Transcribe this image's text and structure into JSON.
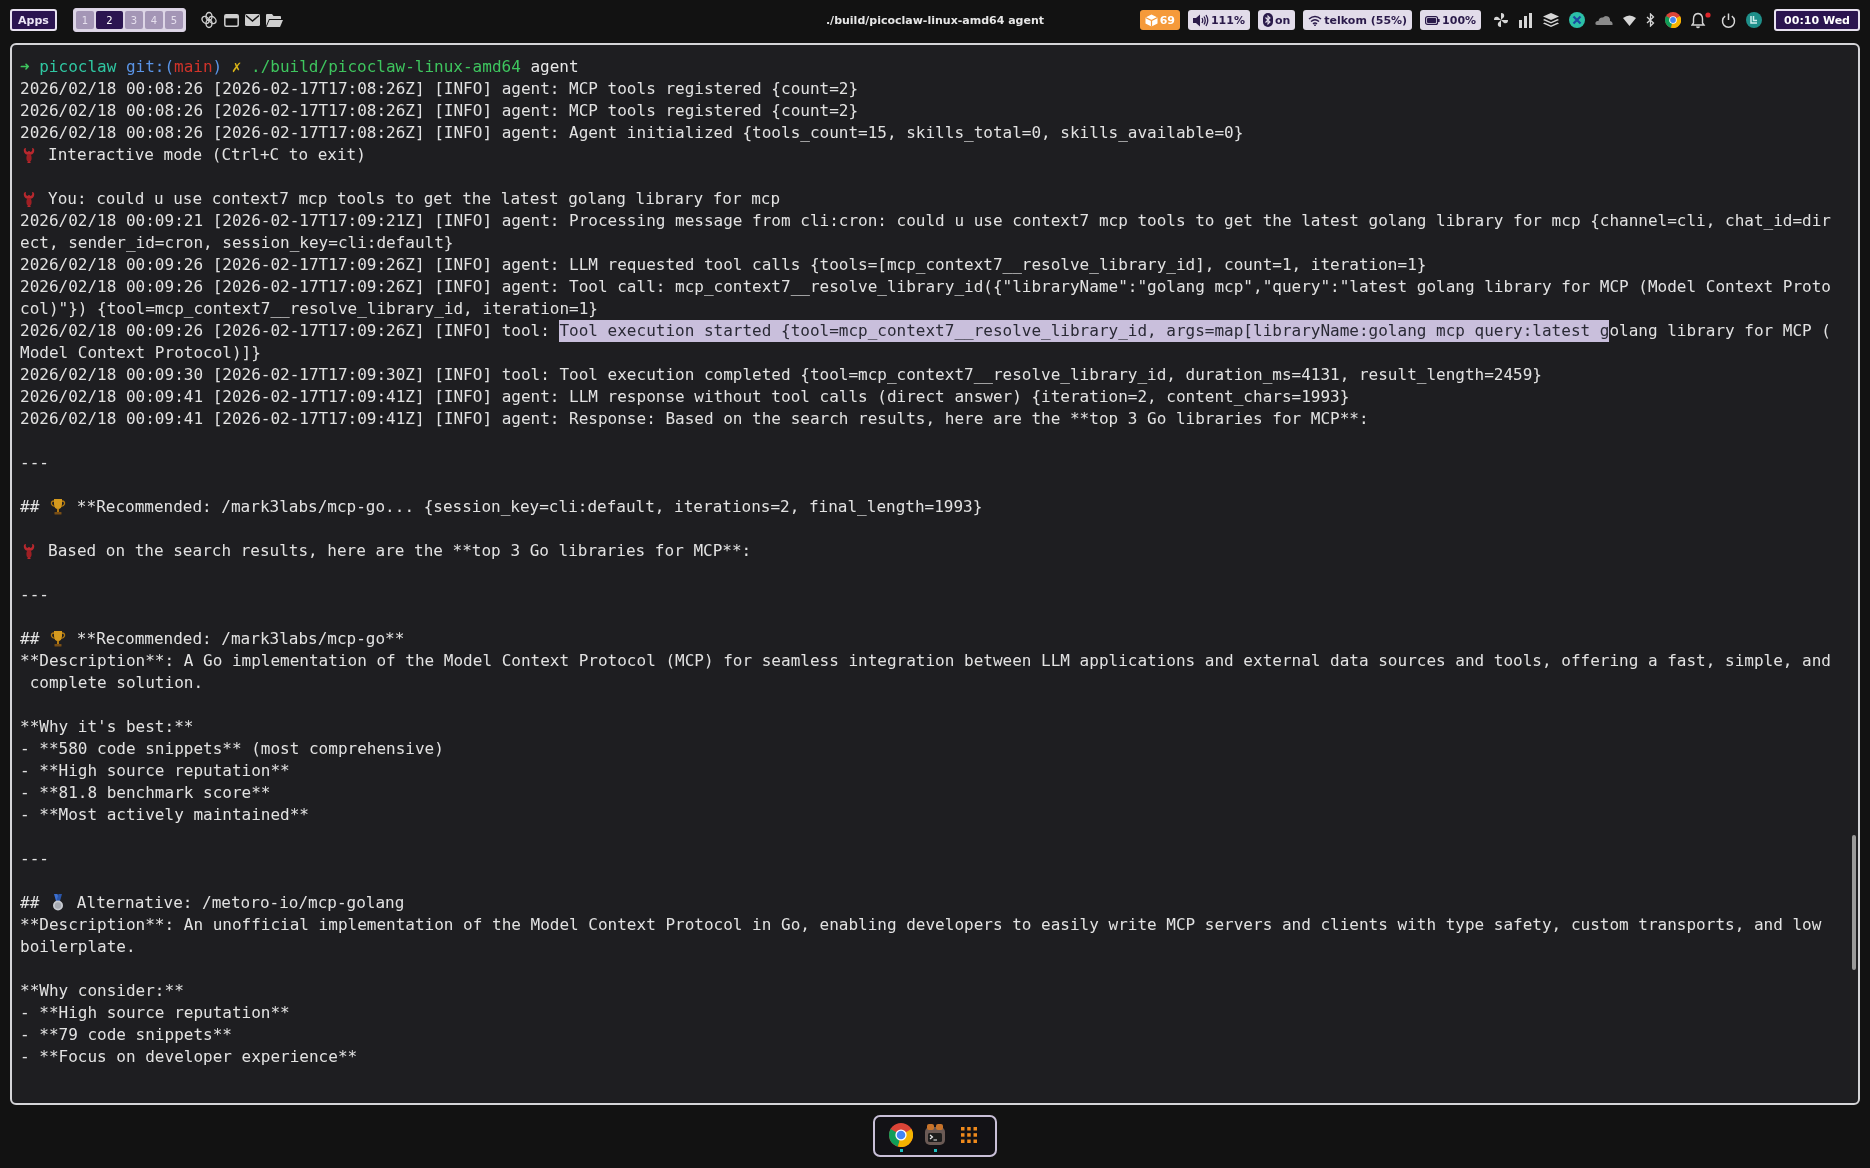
{
  "top_bar": {
    "apps_button": "Apps",
    "workspaces": [
      {
        "label": "1",
        "selected": false
      },
      {
        "label": "2",
        "selected": true
      },
      {
        "label": "3",
        "selected": false
      },
      {
        "label": "4",
        "selected": false
      },
      {
        "label": "5",
        "selected": false
      }
    ],
    "title": "./build/picoclaw-linux-amd64 agent",
    "status_pills": [
      {
        "kind": "updates",
        "text": "69"
      },
      {
        "kind": "volume",
        "text": "111%"
      },
      {
        "kind": "bluetooth",
        "text": "on"
      },
      {
        "kind": "wifi",
        "text": "telkom (55%)"
      },
      {
        "kind": "battery",
        "text": "100%"
      }
    ],
    "clock": "00:10 Wed"
  },
  "terminal": {
    "rows": [
      {
        "kind": "prompt",
        "parts": [
          {
            "text": "➜",
            "color": "#3ec55e",
            "joined": false
          },
          {
            "text": "picoclaw",
            "color": "#2fc7a2",
            "joined": false
          },
          {
            "text": "git:(",
            "color": "#5a94e6",
            "joined": true
          },
          {
            "text": "main",
            "color": "#d0332a",
            "joined": true
          },
          {
            "text": ")",
            "color": "#5a94e6",
            "joined": false
          },
          {
            "text": "✗",
            "color": "#d8b317",
            "joined": false
          },
          {
            "text": "./build/picoclaw-linux-amd64",
            "color": "#3ec55e",
            "joined": false
          },
          {
            "text": "agent",
            "color": "#e8e8e8",
            "joined": false
          }
        ]
      },
      {
        "kind": "text",
        "text": "2026/02/18 00:08:26 [2026-02-17T17:08:26Z] [INFO] agent: MCP tools registered {count=2}"
      },
      {
        "kind": "text",
        "text": "2026/02/18 00:08:26 [2026-02-17T17:08:26Z] [INFO] agent: MCP tools registered {count=2}"
      },
      {
        "kind": "text",
        "text": "2026/02/18 00:08:26 [2026-02-17T17:08:26Z] [INFO] agent: Agent initialized {tools_count=15, skills_total=0, skills_available=0}"
      },
      {
        "kind": "mascot",
        "text": "Interactive mode (Ctrl+C to exit)"
      },
      {
        "kind": "blank"
      },
      {
        "kind": "mascot",
        "text": "You: could u use context7 mcp tools to get the latest golang library for mcp"
      },
      {
        "kind": "text",
        "text": "2026/02/18 00:09:21 [2026-02-17T17:09:21Z] [INFO] agent: Processing message from cli:cron: could u use context7 mcp tools to get the latest golang library for mcp {channel=cli, chat_id=dir"
      },
      {
        "kind": "text",
        "text": "ect, sender_id=cron, session_key=cli:default}"
      },
      {
        "kind": "text",
        "text": "2026/02/18 00:09:26 [2026-02-17T17:09:26Z] [INFO] agent: LLM requested tool calls {tools=[mcp_context7__resolve_library_id], count=1, iteration=1}"
      },
      {
        "kind": "text",
        "text": "2026/02/18 00:09:26 [2026-02-17T17:09:26Z] [INFO] agent: Tool call: mcp_context7__resolve_library_id({\"libraryName\":\"golang mcp\",\"query\":\"latest golang library for MCP (Model Context Proto"
      },
      {
        "kind": "text",
        "text": "col)\"}) {tool=mcp_context7__resolve_library_id, iteration=1}"
      },
      {
        "kind": "parts",
        "parts": [
          {
            "text": "2026/02/18 00:09:26 [2026-02-17T17:09:26Z] [INFO] tool: ",
            "selected": false
          },
          {
            "text": "Tool execution started {tool=mcp_context7__resolve_library_id, args=map[libraryName:golang mcp query:latest g",
            "selected": true
          },
          {
            "text": "olang library for MCP (",
            "selected": false
          }
        ]
      },
      {
        "kind": "text",
        "text": "Model Context Protocol)]}"
      },
      {
        "kind": "text",
        "text": "2026/02/18 00:09:30 [2026-02-17T17:09:30Z] [INFO] tool: Tool execution completed {tool=mcp_context7__resolve_library_id, duration_ms=4131, result_length=2459}"
      },
      {
        "kind": "text",
        "text": "2026/02/18 00:09:41 [2026-02-17T17:09:41Z] [INFO] agent: LLM response without tool calls (direct answer) {iteration=2, content_chars=1993}"
      },
      {
        "kind": "text",
        "text": "2026/02/18 00:09:41 [2026-02-17T17:09:41Z] [INFO] agent: Response: Based on the search results, here are the **top 3 Go libraries for MCP**:"
      },
      {
        "kind": "blank"
      },
      {
        "kind": "text",
        "text": "---"
      },
      {
        "kind": "blank"
      },
      {
        "kind": "trophy",
        "prefix": "##",
        "text": "**Recommended: /mark3labs/mcp-go... {session_key=cli:default, iterations=2, final_length=1993}"
      },
      {
        "kind": "blank"
      },
      {
        "kind": "mascot",
        "text": "Based on the search results, here are the **top 3 Go libraries for MCP**:"
      },
      {
        "kind": "blank"
      },
      {
        "kind": "text",
        "text": "---"
      },
      {
        "kind": "blank"
      },
      {
        "kind": "trophy",
        "prefix": "##",
        "text": "**Recommended: /mark3labs/mcp-go**"
      },
      {
        "kind": "text",
        "text": "**Description**: A Go implementation of the Model Context Protocol (MCP) for seamless integration between LLM applications and external data sources and tools, offering a fast, simple, and"
      },
      {
        "kind": "text",
        "text": " complete solution."
      },
      {
        "kind": "blank"
      },
      {
        "kind": "text",
        "text": "**Why it's best:**"
      },
      {
        "kind": "text",
        "text": "- **580 code snippets** (most comprehensive)"
      },
      {
        "kind": "text",
        "text": "- **High source reputation**"
      },
      {
        "kind": "text",
        "text": "- **81.8 benchmark score**"
      },
      {
        "kind": "text",
        "text": "- **Most actively maintained**"
      },
      {
        "kind": "blank"
      },
      {
        "kind": "text",
        "text": "---"
      },
      {
        "kind": "blank"
      },
      {
        "kind": "medal",
        "prefix": "##",
        "text": "Alternative: /metoro-io/mcp-golang"
      },
      {
        "kind": "text",
        "text": "**Description**: An unofficial implementation of the Model Context Protocol in Go, enabling developers to easily write MCP servers and clients with type safety, custom transports, and low"
      },
      {
        "kind": "text",
        "text": "boilerplate."
      },
      {
        "kind": "blank"
      },
      {
        "kind": "text",
        "text": "**Why consider:**"
      },
      {
        "kind": "text",
        "text": "- **High source reputation**"
      },
      {
        "kind": "text",
        "text": "- **79 code snippets**"
      },
      {
        "kind": "text",
        "text": "- **Focus on developer experience**"
      }
    ]
  },
  "dock": {
    "items": [
      {
        "kind": "browser",
        "running": true
      },
      {
        "kind": "terminal",
        "running": true
      },
      {
        "kind": "apps",
        "running": false
      }
    ]
  }
}
